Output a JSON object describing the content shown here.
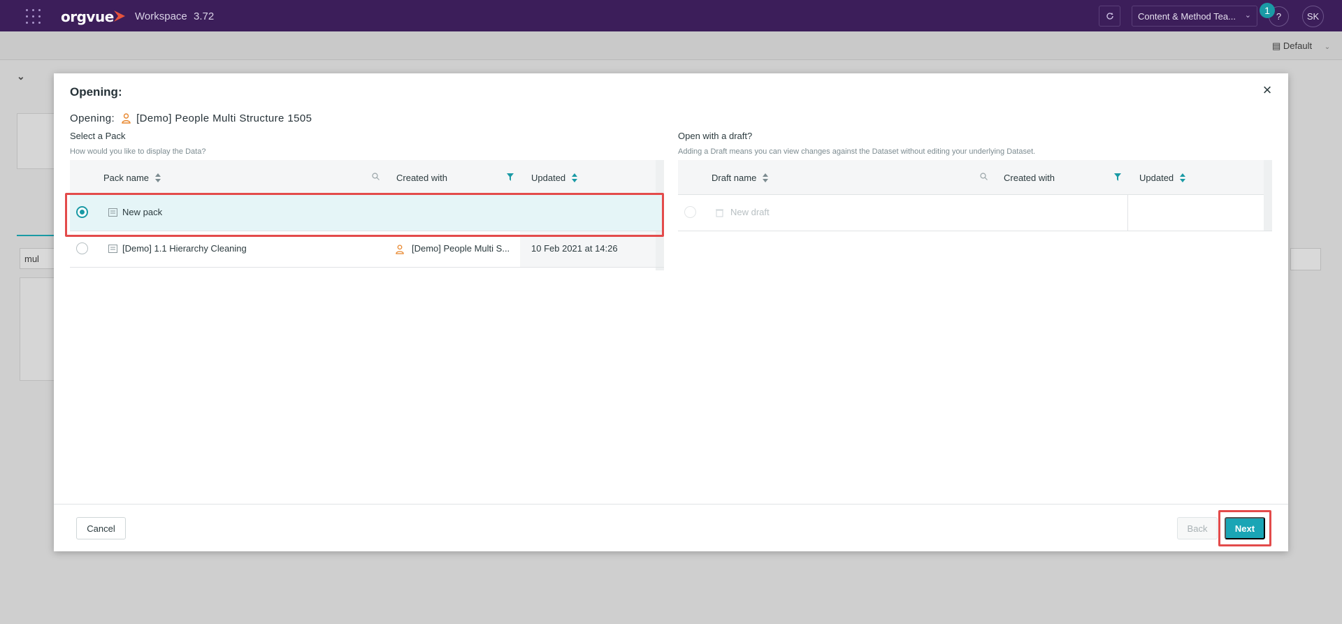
{
  "topbar": {
    "logo": "orgvue",
    "app_name": "Workspace",
    "version": "3.72",
    "team_select": "Content & Method Tea...",
    "notification_count": "1",
    "help": "?",
    "avatar_initials": "SK"
  },
  "background": {
    "view_select": "Default",
    "search_value": "mul"
  },
  "modal": {
    "title": "Opening:",
    "opening_label": "Opening:",
    "dataset_name": "[Demo] People Multi Structure 1505",
    "pack_section": {
      "title": "Select a Pack",
      "subtitle": "How would you like to display the Data?",
      "columns": {
        "name": "Pack name",
        "created_with": "Created with",
        "updated": "Updated"
      },
      "rows": [
        {
          "name": "New pack",
          "created_with": "",
          "updated": "",
          "selected": true
        },
        {
          "name": "[Demo] 1.1 Hierarchy Cleaning",
          "created_with": "[Demo] People Multi S...",
          "updated": "10 Feb 2021 at 14:26",
          "selected": false
        }
      ]
    },
    "draft_section": {
      "title": "Open with a draft?",
      "subtitle": "Adding a Draft means you can view changes against the Dataset without editing your underlying Dataset.",
      "columns": {
        "name": "Draft name",
        "created_with": "Created with",
        "updated": "Updated"
      },
      "rows": [
        {
          "name": "New draft",
          "created_with": "",
          "updated": ""
        }
      ]
    },
    "footer": {
      "cancel": "Cancel",
      "back": "Back",
      "next": "Next"
    }
  },
  "colors": {
    "topbar": "#3c1e5a",
    "accent": "#1aa5b5",
    "highlight": "#e34b4b",
    "person_icon": "#e8872e"
  }
}
